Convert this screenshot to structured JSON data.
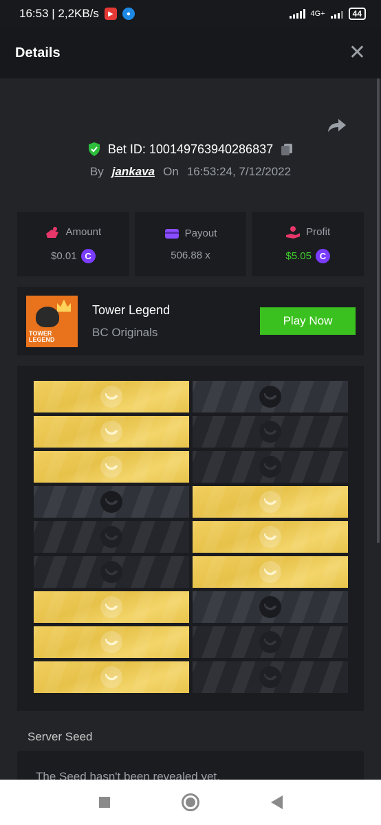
{
  "status_bar": {
    "time_speed": "16:53 | 2,2KB/s",
    "network": "4G+",
    "battery": "44"
  },
  "header": {
    "title": "Details",
    "close_icon": "close-icon"
  },
  "bet": {
    "id_label": "Bet ID: 100149763940286837",
    "by_label": "By",
    "username": "jankava",
    "on_label": "On",
    "datetime": "16:53:24, 7/12/2022"
  },
  "stats": {
    "amount": {
      "label": "Amount",
      "value": "$0.01",
      "coin": "C"
    },
    "payout": {
      "label": "Payout",
      "value": "506.88 x"
    },
    "profit": {
      "label": "Profit",
      "value": "$5.05",
      "coin": "C"
    }
  },
  "game": {
    "name": "Tower Legend",
    "provider": "BC Originals",
    "thumb_text": "TOWER LEGEND",
    "play_label": "Play Now"
  },
  "board": {
    "rows": [
      [
        "gold",
        "dark-revealed"
      ],
      [
        "gold",
        "dark"
      ],
      [
        "gold",
        "dark"
      ],
      [
        "dark-revealed",
        "gold"
      ],
      [
        "dark",
        "gold"
      ],
      [
        "dark",
        "gold"
      ],
      [
        "gold",
        "dark-revealed"
      ],
      [
        "gold",
        "dark"
      ],
      [
        "gold",
        "dark"
      ]
    ]
  },
  "seed": {
    "label": "Server Seed",
    "text": "The Seed hasn't been revealed yet."
  },
  "colors": {
    "accent_green": "#3bc11f",
    "coin_purple": "#7a3cff",
    "profit_green": "#3fd12c",
    "tile_gold": "#f1cf5f"
  }
}
